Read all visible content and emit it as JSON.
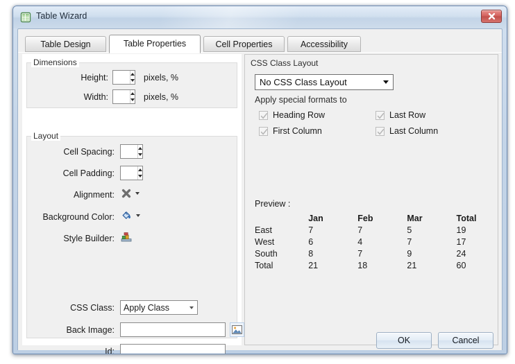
{
  "window": {
    "title": "Table Wizard",
    "icon": "table-document-icon",
    "close_label": "x",
    "close_icon": "close-icon"
  },
  "tabs": [
    {
      "label": "Table Design",
      "active": false
    },
    {
      "label": "Table Properties",
      "active": true
    },
    {
      "label": "Cell Properties",
      "active": false
    },
    {
      "label": "Accessibility",
      "active": false
    }
  ],
  "left_panel": {
    "dimensions": {
      "legend": "Dimensions",
      "height": {
        "label": "Height:",
        "value": "",
        "units": "pixels, %"
      },
      "width": {
        "label": "Width:",
        "value": "",
        "units": "pixels, %"
      }
    },
    "layout": {
      "legend": "Layout",
      "cell_spacing": {
        "label": "Cell Spacing:",
        "value": ""
      },
      "cell_padding": {
        "label": "Cell Padding:",
        "value": ""
      },
      "alignment": {
        "label": "Alignment:",
        "icon": "alignment-none-icon"
      },
      "background_color": {
        "label": "Background Color:",
        "icon": "paint-bucket-icon"
      },
      "style_builder": {
        "label": "Style Builder:",
        "icon": "style-builder-icon"
      },
      "css_class": {
        "label": "CSS Class:",
        "value": "Apply Class"
      },
      "back_image": {
        "label": "Back Image:",
        "value": "",
        "browse_icon": "picture-browse-icon"
      },
      "id": {
        "label": "Id:",
        "value": ""
      }
    }
  },
  "right_panel": {
    "legend": "CSS Class Layout",
    "layout_select": {
      "value": "No CSS Class Layout"
    },
    "apply_formats_label": "Apply special formats to",
    "checkboxes": [
      {
        "label": "Heading Row",
        "checked": true,
        "disabled": true
      },
      {
        "label": "Last Row",
        "checked": true,
        "disabled": true
      },
      {
        "label": "First Column",
        "checked": true,
        "disabled": true
      },
      {
        "label": "Last Column",
        "checked": true,
        "disabled": true
      }
    ],
    "preview_label": "Preview :",
    "preview_table": {
      "headers": [
        "",
        "Jan",
        "Feb",
        "Mar",
        "Total"
      ],
      "rows": [
        [
          "East",
          "7",
          "7",
          "5",
          "19"
        ],
        [
          "West",
          "6",
          "4",
          "7",
          "17"
        ],
        [
          "South",
          "8",
          "7",
          "9",
          "24"
        ],
        [
          "Total",
          "21",
          "18",
          "21",
          "60"
        ]
      ]
    }
  },
  "footer": {
    "ok_label": "OK",
    "cancel_label": "Cancel"
  },
  "colors": {
    "titlebar_accent": "#c0d2e6",
    "close_red": "#c2504b",
    "window_border": "#6f8db3",
    "panel_bg": "#f0f0f0"
  },
  "chart_data": {
    "type": "table",
    "title": "Preview :",
    "columns": [
      "",
      "Jan",
      "Feb",
      "Mar",
      "Total"
    ],
    "rows": [
      {
        "region": "East",
        "Jan": 7,
        "Feb": 7,
        "Mar": 5,
        "Total": 19
      },
      {
        "region": "West",
        "Jan": 6,
        "Feb": 4,
        "Mar": 7,
        "Total": 17
      },
      {
        "region": "South",
        "Jan": 8,
        "Feb": 7,
        "Mar": 9,
        "Total": 24
      },
      {
        "region": "Total",
        "Jan": 21,
        "Feb": 18,
        "Mar": 21,
        "Total": 60
      }
    ]
  }
}
